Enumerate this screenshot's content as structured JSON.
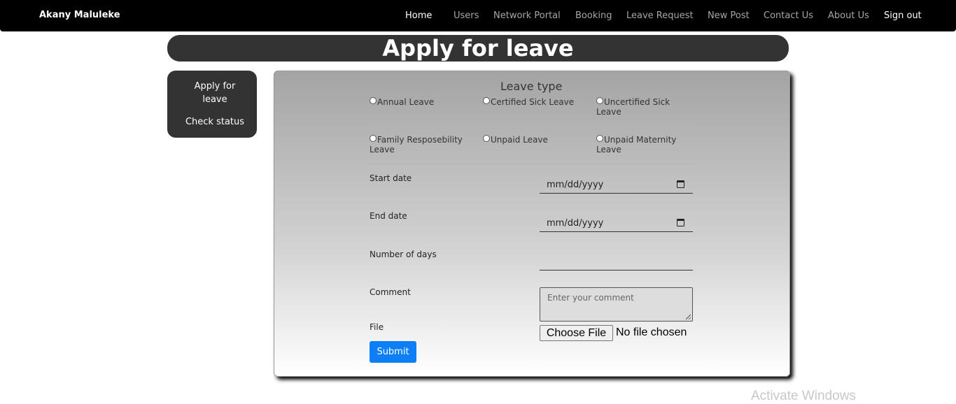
{
  "navbar": {
    "brand": "Akany Maluleke",
    "links": [
      "Home",
      "Users",
      "Network Portal",
      "Booking",
      "Leave Request",
      "New Post",
      "Contact Us",
      "About Us",
      "Sign out"
    ]
  },
  "page": {
    "title": "Apply for leave"
  },
  "sidebar": {
    "items": [
      "Apply for leave",
      "Check status"
    ]
  },
  "form": {
    "leave_type_legend": "Leave type",
    "leave_types": [
      "Annual Leave",
      "Certified Sick Leave",
      "Uncertified Sick Leave",
      "Family Resposebility Leave",
      "Unpaid Leave",
      "Unpaid Maternity Leave"
    ],
    "start_date_label": "Start date",
    "start_date_value": "mm/dd/yyyy",
    "end_date_label": "End date",
    "end_date_value": "mm/dd/yyyy",
    "days_label": "Number of days",
    "days_value": "",
    "comment_label": "Comment",
    "comment_placeholder": "Enter your comment",
    "file_label": "File",
    "file_button": "Choose File",
    "file_status": "No file chosen",
    "submit_label": "Submit"
  },
  "overlay": {
    "watermark": "Activate Windows"
  },
  "colors": {
    "navbar_bg": "#000000",
    "panel_bg": "#333333",
    "submit_bg": "#0d7ff6",
    "nav_inactive": "#a6a6a6"
  }
}
